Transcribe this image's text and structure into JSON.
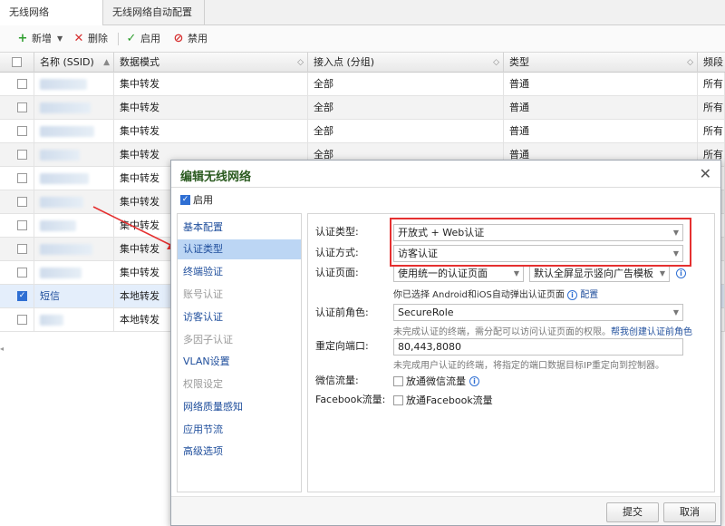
{
  "tabs": [
    {
      "label": "无线网络"
    },
    {
      "label": "无线网络自动配置"
    }
  ],
  "toolbar": {
    "add": "新增",
    "delete": "删除",
    "enable": "启用",
    "disable": "禁用"
  },
  "grid": {
    "columns": [
      "名称 (SSID)",
      "数据模式",
      "接入点 (分组)",
      "类型",
      "频段"
    ],
    "rows": [
      {
        "ssid": "",
        "mode": "集中转发",
        "ap": "全部",
        "type": "普通",
        "band": "所有"
      },
      {
        "ssid": "",
        "mode": "集中转发",
        "ap": "全部",
        "type": "普通",
        "band": "所有"
      },
      {
        "ssid": "",
        "mode": "集中转发",
        "ap": "全部",
        "type": "普通",
        "band": "所有"
      },
      {
        "ssid": "",
        "mode": "集中转发",
        "ap": "全部",
        "type": "普通",
        "band": "所有"
      },
      {
        "ssid": "",
        "mode": "集中转发",
        "ap": "",
        "type": "",
        "band": ""
      },
      {
        "ssid": "",
        "mode": "集中转发",
        "ap": "",
        "type": "",
        "band": ""
      },
      {
        "ssid": "",
        "mode": "集中转发",
        "ap": "",
        "type": "",
        "band": ""
      },
      {
        "ssid": "",
        "mode": "集中转发",
        "ap": "",
        "type": "",
        "band": ""
      },
      {
        "ssid": "",
        "mode": "集中转发",
        "ap": "",
        "type": "",
        "band": ""
      },
      {
        "ssid": "短信",
        "mode": "本地转发",
        "ap": "",
        "type": "",
        "band": ""
      },
      {
        "ssid": "",
        "mode": "本地转发",
        "ap": "",
        "type": "",
        "band": ""
      }
    ]
  },
  "dialog": {
    "title": "编辑无线网络",
    "enable_label": "启用",
    "nav": [
      {
        "label": "基本配置"
      },
      {
        "label": "认证类型"
      },
      {
        "label": "终端验证"
      },
      {
        "label": "账号认证"
      },
      {
        "label": "访客认证"
      },
      {
        "label": "多因子认证"
      },
      {
        "label": "VLAN设置"
      },
      {
        "label": "权限设定"
      },
      {
        "label": "网络质量感知"
      },
      {
        "label": "应用节流"
      },
      {
        "label": "高级选项"
      }
    ],
    "form": {
      "auth_type_label": "认证类型:",
      "auth_type_value": "开放式 + Web认证",
      "auth_method_label": "认证方式:",
      "auth_method_value": "访客认证",
      "auth_page_label": "认证页面:",
      "auth_page_value": "使用统一的认证页面",
      "auth_page_template": "默认全屏显示竖向广告模板",
      "android_hint": "你已选择 Android和iOS自动弹出认证页面",
      "config_link": "配置",
      "pre_role_label": "认证前角色:",
      "pre_role_value": "SecureRole",
      "pre_role_hint": "未完成认证的终端，需分配可以访问认证页面的权限。",
      "pre_role_link": "帮我创建认证前角色",
      "redirect_label": "重定向端口:",
      "redirect_value": "80,443,8080",
      "redirect_hint": "未完成用户认证的终端，将指定的端口数据目标IP重定向到控制器。",
      "wechat_label": "微信流量:",
      "wechat_option": "放通微信流量",
      "facebook_label": "Facebook流量:",
      "facebook_option": "放通Facebook流量"
    },
    "submit": "提交",
    "cancel": "取消"
  },
  "colors": {
    "accent": "#2f6fd3",
    "highlight_box": "#e53030",
    "title_green": "#2a5a1f"
  }
}
